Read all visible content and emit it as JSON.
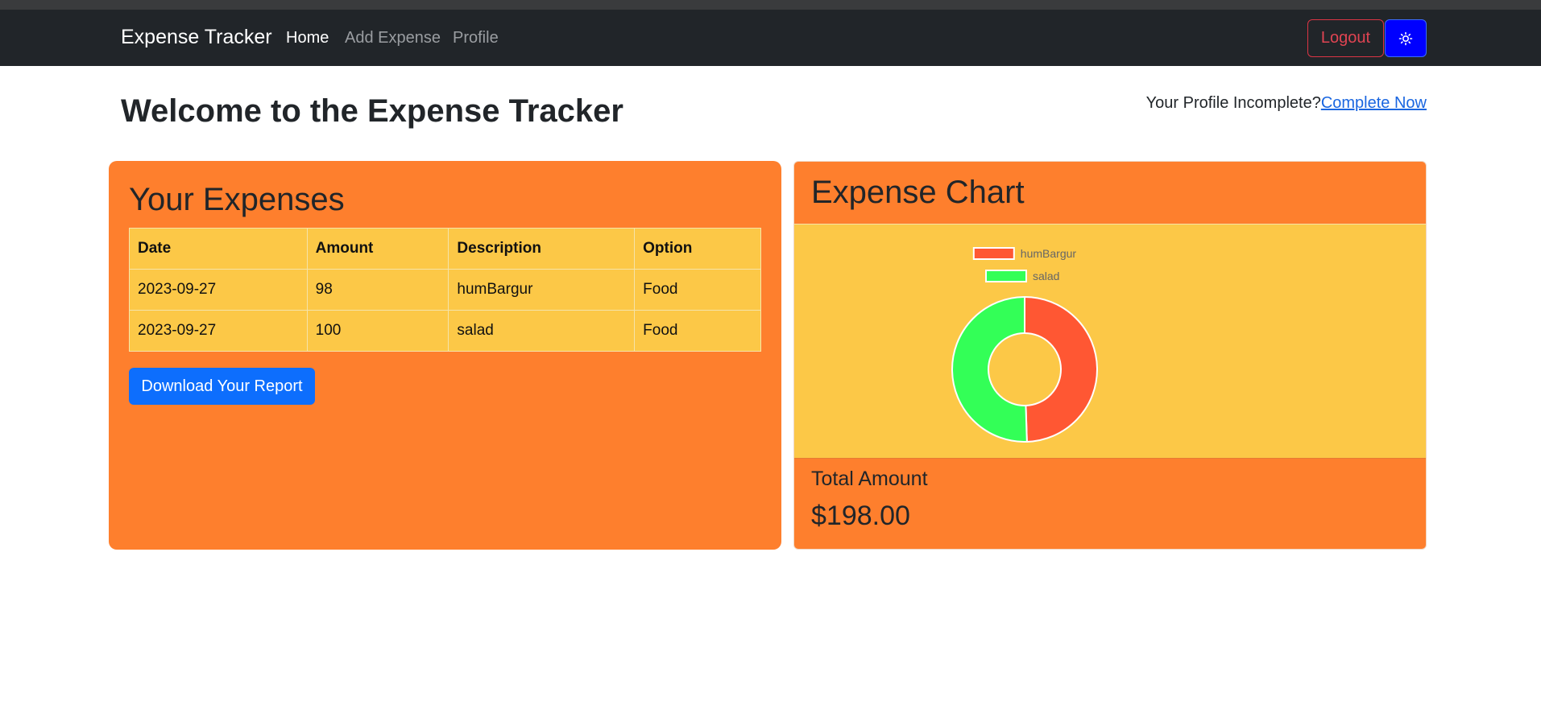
{
  "nav": {
    "brand": "Expense Tracker",
    "links": [
      {
        "label": "Home",
        "active": true
      },
      {
        "label": "Add Expense",
        "active": false
      },
      {
        "label": "Profile",
        "active": false
      }
    ],
    "logout_label": "Logout",
    "theme_icon": "sun-icon"
  },
  "main": {
    "title": "Welcome to the Expense Tracker",
    "profile_prompt": "Your Profile Incomplete?",
    "profile_link": "Complete Now"
  },
  "expenses": {
    "title": "Your Expenses",
    "columns": [
      "Date",
      "Amount",
      "Description",
      "Option"
    ],
    "rows": [
      [
        "2023-09-27",
        "98",
        "humBargur",
        "Food"
      ],
      [
        "2023-09-27",
        "100",
        "salad",
        "Food"
      ]
    ],
    "download_label": "Download Your Report"
  },
  "chart_card": {
    "title": "Expense Chart",
    "total_label": "Total Amount",
    "total_value": "$198.00"
  },
  "chart_data": {
    "type": "pie",
    "categories": [
      "humBargur",
      "salad"
    ],
    "values": [
      98,
      100
    ],
    "colors": [
      "#ff5733",
      "#33ff57"
    ],
    "legend": "top"
  },
  "colors": {
    "card_bg": "#fe7f2d",
    "table_bg": "#fcc847",
    "primary": "#0d6efd",
    "danger": "#dc3545",
    "navbar": "#212529"
  }
}
